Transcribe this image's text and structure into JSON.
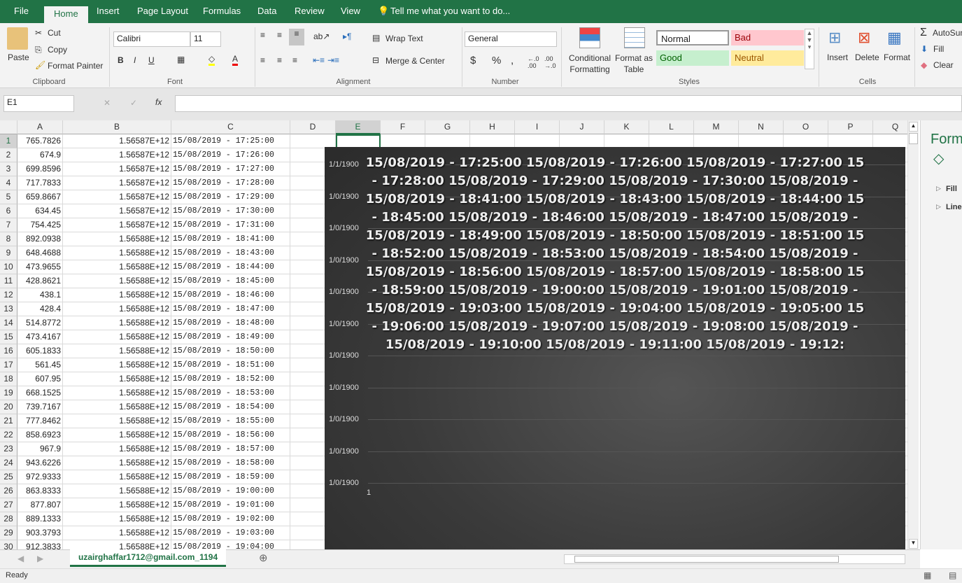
{
  "tabs": [
    "File",
    "Home",
    "Insert",
    "Page Layout",
    "Formulas",
    "Data",
    "Review",
    "View"
  ],
  "tell_me": "Tell me what you want to do...",
  "clipboard": {
    "paste": "Paste",
    "cut": "Cut",
    "copy": "Copy",
    "format_painter": "Format Painter",
    "group": "Clipboard"
  },
  "font": {
    "name": "Calibri",
    "size": "11",
    "bold": "B",
    "italic": "I",
    "underline": "U",
    "group": "Font"
  },
  "alignment": {
    "wrap": "Wrap Text",
    "merge": "Merge & Center",
    "group": "Alignment"
  },
  "number": {
    "format": "General",
    "currency": "$",
    "percent": "%",
    "comma": ",",
    "group": "Number"
  },
  "styles": {
    "conditional": "Conditional Formatting",
    "format_table": "Format as Table",
    "normal": "Normal",
    "bad": "Bad",
    "good": "Good",
    "neutral": "Neutral",
    "group": "Styles"
  },
  "cells": {
    "insert": "Insert",
    "delete": "Delete",
    "format": "Format",
    "group": "Cells"
  },
  "editing": {
    "autosum": "AutoSum",
    "fill": "Fill",
    "clear": "Clear"
  },
  "formula_bar": {
    "name_box": "E1",
    "fx": "fx",
    "value": ""
  },
  "columns": [
    "A",
    "B",
    "C",
    "D",
    "E",
    "F",
    "G",
    "H",
    "I",
    "J",
    "K",
    "L",
    "M",
    "N",
    "O",
    "P",
    "Q"
  ],
  "rows": [
    [
      "765.7826",
      "1.56587E+12",
      "15/08/2019 - 17:25:00"
    ],
    [
      "674.9",
      "1.56587E+12",
      "15/08/2019 - 17:26:00"
    ],
    [
      "699.8596",
      "1.56587E+12",
      "15/08/2019 - 17:27:00"
    ],
    [
      "717.7833",
      "1.56587E+12",
      "15/08/2019 - 17:28:00"
    ],
    [
      "659.8667",
      "1.56587E+12",
      "15/08/2019 - 17:29:00"
    ],
    [
      "634.45",
      "1.56587E+12",
      "15/08/2019 - 17:30:00"
    ],
    [
      "754.425",
      "1.56587E+12",
      "15/08/2019 - 17:31:00"
    ],
    [
      "892.0938",
      "1.56588E+12",
      "15/08/2019 - 18:41:00"
    ],
    [
      "648.4688",
      "1.56588E+12",
      "15/08/2019 - 18:43:00"
    ],
    [
      "473.9655",
      "1.56588E+12",
      "15/08/2019 - 18:44:00"
    ],
    [
      "428.8621",
      "1.56588E+12",
      "15/08/2019 - 18:45:00"
    ],
    [
      "438.1",
      "1.56588E+12",
      "15/08/2019 - 18:46:00"
    ],
    [
      "428.4",
      "1.56588E+12",
      "15/08/2019 - 18:47:00"
    ],
    [
      "514.8772",
      "1.56588E+12",
      "15/08/2019 - 18:48:00"
    ],
    [
      "473.4167",
      "1.56588E+12",
      "15/08/2019 - 18:49:00"
    ],
    [
      "605.1833",
      "1.56588E+12",
      "15/08/2019 - 18:50:00"
    ],
    [
      "561.45",
      "1.56588E+12",
      "15/08/2019 - 18:51:00"
    ],
    [
      "607.95",
      "1.56588E+12",
      "15/08/2019 - 18:52:00"
    ],
    [
      "668.1525",
      "1.56588E+12",
      "15/08/2019 - 18:53:00"
    ],
    [
      "739.7167",
      "1.56588E+12",
      "15/08/2019 - 18:54:00"
    ],
    [
      "777.8462",
      "1.56588E+12",
      "15/08/2019 - 18:55:00"
    ],
    [
      "858.6923",
      "1.56588E+12",
      "15/08/2019 - 18:56:00"
    ],
    [
      "967.9",
      "1.56588E+12",
      "15/08/2019 - 18:57:00"
    ],
    [
      "943.6226",
      "1.56588E+12",
      "15/08/2019 - 18:58:00"
    ],
    [
      "972.9333",
      "1.56588E+12",
      "15/08/2019 - 18:59:00"
    ],
    [
      "863.8333",
      "1.56588E+12",
      "15/08/2019 - 19:00:00"
    ],
    [
      "877.807",
      "1.56588E+12",
      "15/08/2019 - 19:01:00"
    ],
    [
      "889.1333",
      "1.56588E+12",
      "15/08/2019 - 19:02:00"
    ],
    [
      "903.3793",
      "1.56588E+12",
      "15/08/2019 - 19:03:00"
    ],
    [
      "912.3833",
      "1.56588E+12",
      "15/08/2019 - 19:04:00"
    ]
  ],
  "chart": {
    "title_lines": [
      "15/08/2019 - 17:25:00 15/08/2019 - 17:26:00 15/08/2019 - 17:27:00 15",
      "- 17:28:00 15/08/2019 - 17:29:00 15/08/2019 - 17:30:00 15/08/2019 -",
      "15/08/2019 - 18:41:00 15/08/2019 - 18:43:00 15/08/2019 - 18:44:00 15",
      "- 18:45:00 15/08/2019 - 18:46:00 15/08/2019 - 18:47:00 15/08/2019 -",
      "15/08/2019 - 18:49:00 15/08/2019 - 18:50:00 15/08/2019 - 18:51:00 15",
      "- 18:52:00 15/08/2019 - 18:53:00 15/08/2019 - 18:54:00 15/08/2019 -",
      "15/08/2019 - 18:56:00 15/08/2019 - 18:57:00 15/08/2019 - 18:58:00 15",
      "- 18:59:00 15/08/2019 - 19:00:00 15/08/2019 - 19:01:00 15/08/2019 -",
      "15/08/2019 - 19:03:00 15/08/2019 - 19:04:00 15/08/2019 - 19:05:00 15",
      "- 19:06:00 15/08/2019 - 19:07:00 15/08/2019 - 19:08:00 15/08/2019 -",
      "15/08/2019 - 19:10:00 15/08/2019 - 19:11:00 15/08/2019 - 19:12:"
    ],
    "y_ticks": [
      "1/1/1900",
      "1/0/1900",
      "1/0/1900",
      "1/0/1900",
      "1/0/1900",
      "1/0/1900",
      "1/0/1900",
      "1/0/1900",
      "1/0/1900",
      "1/0/1900",
      "1/0/1900"
    ],
    "x_ticks": [
      "1"
    ]
  },
  "format_pane": {
    "title": "Form",
    "fill": "Fill",
    "line": "Line"
  },
  "sheet_tab": "uzairghaffar1712@gmail.com_1194",
  "status": "Ready"
}
